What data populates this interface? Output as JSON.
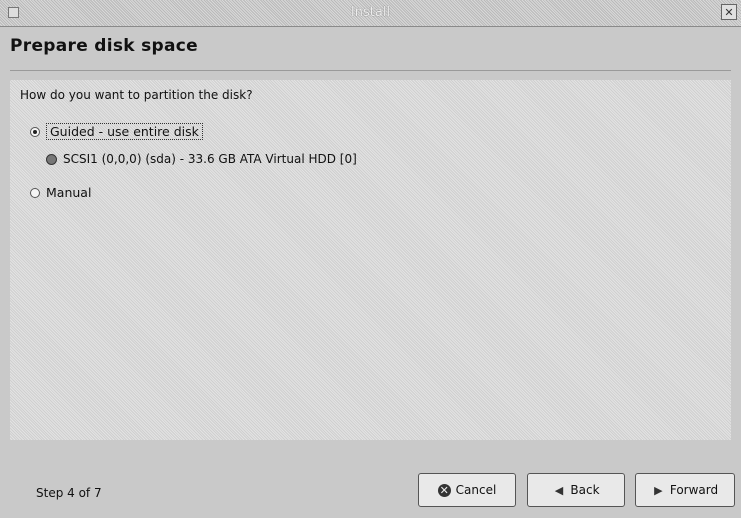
{
  "window": {
    "title": "Install",
    "close_glyph": "✕"
  },
  "page": {
    "heading": "Prepare disk space",
    "question": "How do you want to partition the disk?"
  },
  "options": {
    "guided": {
      "label": "Guided - use entire disk",
      "selected": true
    },
    "disk": {
      "label": "SCSI1 (0,0,0) (sda) - 33.6 GB ATA Virtual HDD [0]"
    },
    "manual": {
      "label": "Manual",
      "selected": false
    }
  },
  "footer": {
    "step": "Step 4 of 7",
    "cancel_label": "Cancel",
    "back_label": "Back",
    "forward_label": "Forward"
  }
}
